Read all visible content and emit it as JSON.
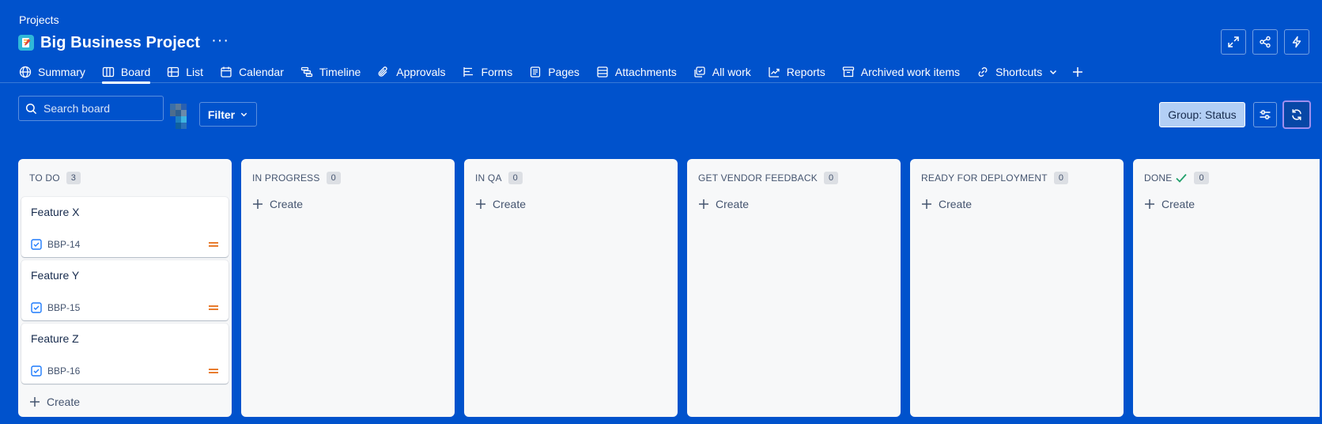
{
  "breadcrumb": "Projects",
  "project": {
    "title": "Big Business Project",
    "more": "···"
  },
  "tabs": [
    {
      "label": "Summary",
      "icon": "globe-icon"
    },
    {
      "label": "Board",
      "icon": "board-icon",
      "active": true
    },
    {
      "label": "List",
      "icon": "list-icon"
    },
    {
      "label": "Calendar",
      "icon": "calendar-icon"
    },
    {
      "label": "Timeline",
      "icon": "timeline-icon"
    },
    {
      "label": "Approvals",
      "icon": "paperclip-icon"
    },
    {
      "label": "Forms",
      "icon": "forms-icon"
    },
    {
      "label": "Pages",
      "icon": "page-icon"
    },
    {
      "label": "Attachments",
      "icon": "attachments-icon"
    },
    {
      "label": "All work",
      "icon": "all-work-icon"
    },
    {
      "label": "Reports",
      "icon": "reports-icon"
    },
    {
      "label": "Archived work items",
      "icon": "archive-icon"
    },
    {
      "label": "Shortcuts",
      "icon": "link-icon"
    }
  ],
  "toolbar": {
    "search_placeholder": "Search board",
    "filter_label": "Filter",
    "group_label": "Group: Status"
  },
  "columns": [
    {
      "title": "TO DO",
      "count": "3",
      "create_label": "Create",
      "cards": [
        {
          "title": "Feature X",
          "key": "BBP-14"
        },
        {
          "title": "Feature Y",
          "key": "BBP-15"
        },
        {
          "title": "Feature Z",
          "key": "BBP-16"
        }
      ]
    },
    {
      "title": "IN PROGRESS",
      "count": "0",
      "create_label": "Create",
      "cards": []
    },
    {
      "title": "IN QA",
      "count": "0",
      "create_label": "Create",
      "cards": []
    },
    {
      "title": "GET VENDOR FEEDBACK",
      "count": "0",
      "create_label": "Create",
      "cards": []
    },
    {
      "title": "READY FOR DEPLOYMENT",
      "count": "0",
      "create_label": "Create",
      "cards": []
    },
    {
      "title": "DONE",
      "count": "0",
      "create_label": "Create",
      "cards": [],
      "done": true
    }
  ],
  "colors": {
    "background": "#0052cc",
    "column_bg": "#f7f8f9",
    "priority": "#e56910",
    "task_icon": "#1d7afc",
    "done_check": "#22a06b",
    "focus_ring": "#9f8fef"
  }
}
